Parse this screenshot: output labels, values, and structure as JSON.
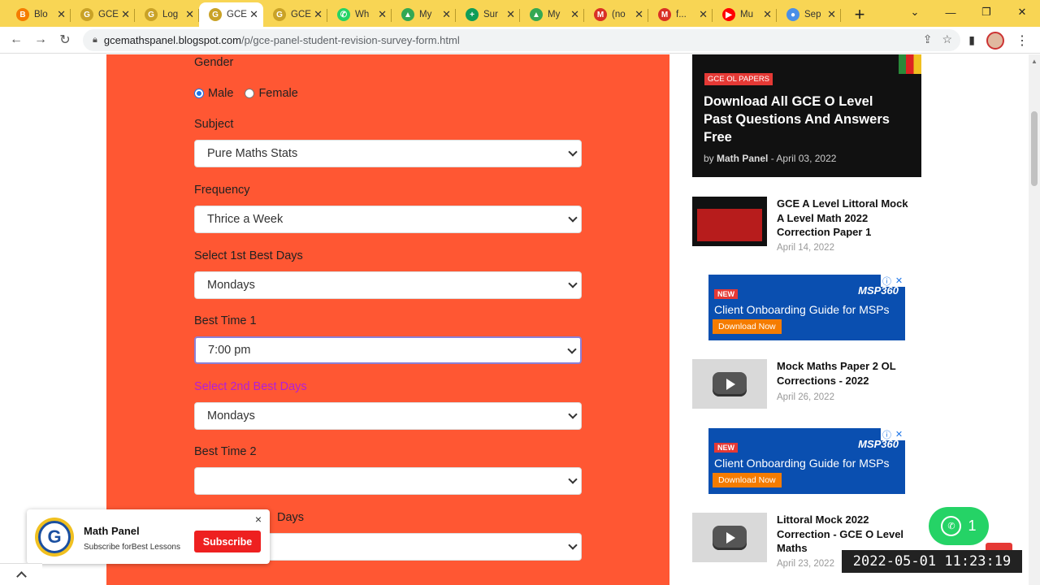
{
  "browser": {
    "tabs": [
      {
        "label": "Blo",
        "icon": "blogger-icon",
        "color": "#f57c00",
        "glyph": "B",
        "active": false
      },
      {
        "label": "GCE",
        "icon": "gce-logo-icon",
        "color": "#c9a227",
        "glyph": "G",
        "active": false
      },
      {
        "label": "Log",
        "icon": "gce-logo-icon",
        "color": "#c9a227",
        "glyph": "G",
        "active": false
      },
      {
        "label": "GCE",
        "icon": "gce-logo-icon",
        "color": "#c9a227",
        "glyph": "G",
        "active": true
      },
      {
        "label": "GCE",
        "icon": "gce-logo-icon",
        "color": "#c9a227",
        "glyph": "G",
        "active": false
      },
      {
        "label": "Wh",
        "icon": "whatsapp-icon",
        "color": "#25d366",
        "glyph": "✆",
        "active": false
      },
      {
        "label": "My",
        "icon": "drive-icon",
        "color": "#34a853",
        "glyph": "▲",
        "active": false
      },
      {
        "label": "Sur",
        "icon": "sheets-icon",
        "color": "#0f9d58",
        "glyph": "+",
        "active": false
      },
      {
        "label": "My",
        "icon": "drive-icon",
        "color": "#34a853",
        "glyph": "▲",
        "active": false
      },
      {
        "label": "(no",
        "icon": "gmail-icon",
        "color": "#d93025",
        "glyph": "M",
        "active": false
      },
      {
        "label": "f...",
        "icon": "gmail-icon",
        "color": "#d93025",
        "glyph": "M",
        "active": false
      },
      {
        "label": "Mu",
        "icon": "youtube-icon",
        "color": "#ff0000",
        "glyph": "▶",
        "active": false
      },
      {
        "label": "Sep",
        "icon": "chat-icon",
        "color": "#4a8fe7",
        "glyph": "●",
        "active": false
      }
    ],
    "new_tab": "+",
    "url_host": "gcemathspanel.blogspot.com",
    "url_path": "/p/gce-panel-student-revision-survey-form.html"
  },
  "form": {
    "gender_label": "Gender",
    "gender_options": [
      "Male",
      "Female"
    ],
    "gender_selected": "Male",
    "subject_label": "Subject",
    "subject_value": "Pure Maths Stats",
    "frequency_label": "Frequency",
    "frequency_value": "Thrice a Week",
    "best_days_1_label": "Select 1st Best Days",
    "best_days_1_value": "Mondays",
    "best_time_1_label": "Best Time 1",
    "best_time_1_value": "7:00 pm",
    "best_days_2_label": "Select 2nd Best Days",
    "best_days_2_value": "Mondays",
    "best_time_2_label": "Best Time 2",
    "best_time_2_value": "",
    "best_days_3_label_visible": "Days",
    "best_days_3_value": ""
  },
  "sidebar": {
    "featured": {
      "category": "GCE OL PAPERS",
      "title": "Download All GCE O Level Past Questions And Answers Free",
      "author": "Math Panel",
      "date": "April 03, 2022"
    },
    "posts": [
      {
        "title": "GCE A Level Littoral Mock A Level Math 2022 Correction Paper 1",
        "date": "April 14, 2022"
      },
      {
        "title": "Mock Maths Paper 2 OL Corrections - 2022",
        "date": "April 26, 2022"
      },
      {
        "title": "Littoral Mock 2022 Correction - GCE O Level Maths",
        "date": "April 23, 2022"
      }
    ],
    "ad": {
      "badge": "NEW",
      "brand": "MSP360",
      "text": "Client Onboarding Guide for MSPs",
      "button": "Download Now"
    }
  },
  "popup": {
    "channel": "Math Panel",
    "tagline": "Subscribe forBest Lessons",
    "subscribe": "Subscribe",
    "close": "×"
  },
  "whatsapp": {
    "count": "1"
  },
  "overlay": {
    "timestamp": "2022-05-01  11:23:19"
  },
  "colors": {
    "form_bg": "#ff5733",
    "tab_strip": "#f8d554",
    "accent_purple": "#b21fd8"
  }
}
